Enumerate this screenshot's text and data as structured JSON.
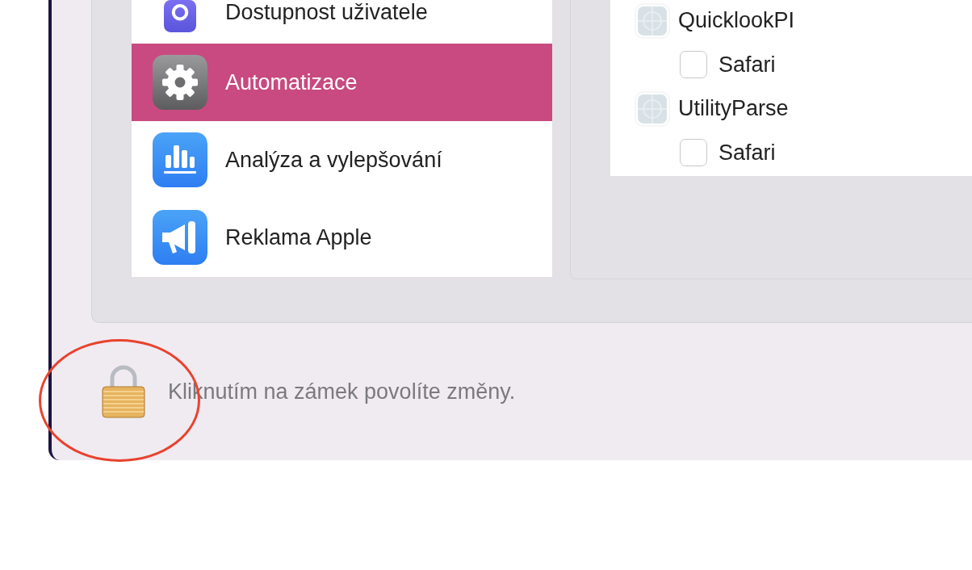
{
  "sidebar": {
    "items": [
      {
        "label": "Dostupnost uživatele",
        "kind": "accessibility",
        "selected": false
      },
      {
        "label": "Automatizace",
        "kind": "gear",
        "selected": true
      },
      {
        "label": "Analýza a vylepšování",
        "kind": "chart",
        "selected": false
      },
      {
        "label": "Reklama Apple",
        "kind": "megaphone",
        "selected": false
      }
    ]
  },
  "permissions": [
    {
      "name": "QuicklookPI",
      "children": [
        {
          "name": "Safari",
          "checked": false
        }
      ]
    },
    {
      "name": "UtilityParse",
      "children": [
        {
          "name": "Safari",
          "checked": false
        }
      ]
    }
  ],
  "lock": {
    "locked": true,
    "message": "Kliknutím na zámek povolíte změny."
  },
  "annotation": {
    "kind": "circle",
    "color": "#e8432e"
  }
}
